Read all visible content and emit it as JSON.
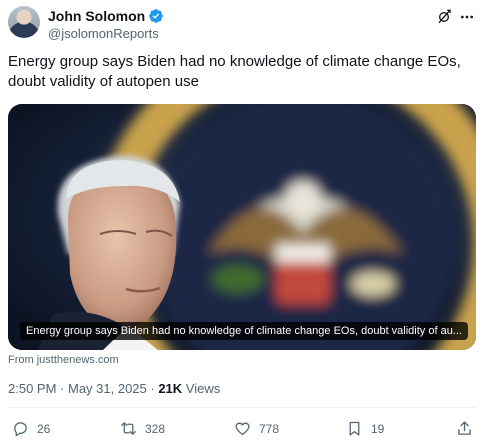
{
  "author": {
    "display_name": "John Solomon",
    "handle": "@jsolomonReports",
    "verified": true
  },
  "tweet": {
    "text": "Energy group says Biden had no knowledge of climate change EOs, doubt validity of autopen use"
  },
  "media": {
    "caption": "Energy group says Biden had no knowledge of climate change EOs, doubt validity of au..."
  },
  "source": "From justthenews.com",
  "meta": {
    "time": "2:50 PM",
    "separator": " · ",
    "date": "May 31, 2025",
    "views_count": "21K",
    "views_label": " Views"
  },
  "actions": {
    "replies": "26",
    "reposts": "328",
    "likes": "778",
    "bookmarks": "19"
  },
  "colors": {
    "text": "#0f1419",
    "secondary": "#536471",
    "verified": "#1d9bf0"
  },
  "icons": [
    "verified-badge-icon",
    "grok-icon",
    "more-icon",
    "reply-icon",
    "repost-icon",
    "like-icon",
    "bookmark-icon",
    "share-icon"
  ]
}
